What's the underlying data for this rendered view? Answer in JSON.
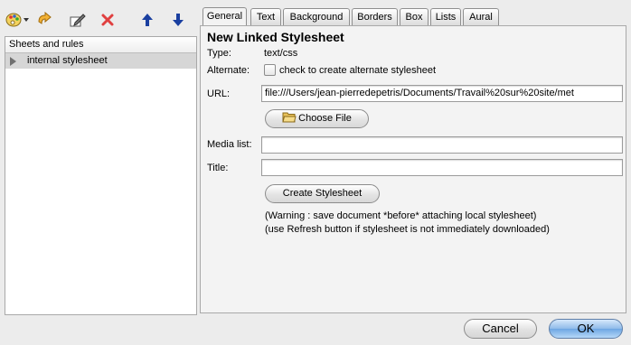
{
  "toolbar": {
    "icons": [
      "style-palette-icon",
      "dropdown-arrow-icon",
      "refresh-icon",
      "edit-icon",
      "delete-icon",
      "move-up-icon",
      "move-down-icon"
    ]
  },
  "tree": {
    "header": "Sheets and rules",
    "items": [
      {
        "label": "internal stylesheet"
      }
    ]
  },
  "tabs": [
    {
      "label": "General",
      "selected": true
    },
    {
      "label": "Text"
    },
    {
      "label": "Background"
    },
    {
      "label": "Borders"
    },
    {
      "label": "Box"
    },
    {
      "label": "Lists"
    },
    {
      "label": "Aural"
    }
  ],
  "form": {
    "heading": "New Linked Stylesheet",
    "type_label": "Type:",
    "type_value": "text/css",
    "alternate_label": "Alternate:",
    "alternate_checkbox_label": "check to create alternate stylesheet",
    "url_label": "URL:",
    "url_value": "file:///Users/jean-pierredepetris/Documents/Travail%20sur%20site/met",
    "choose_file_label": "Choose File",
    "media_label": "Media list:",
    "media_value": "",
    "title_label": "Title:",
    "title_value": "",
    "create_label": "Create Stylesheet",
    "warning_1": "(Warning : save document *before* attaching local stylesheet)",
    "warning_2": "(use Refresh button if stylesheet is not immediately downloaded)"
  },
  "buttons": {
    "cancel": "Cancel",
    "ok": "OK"
  }
}
